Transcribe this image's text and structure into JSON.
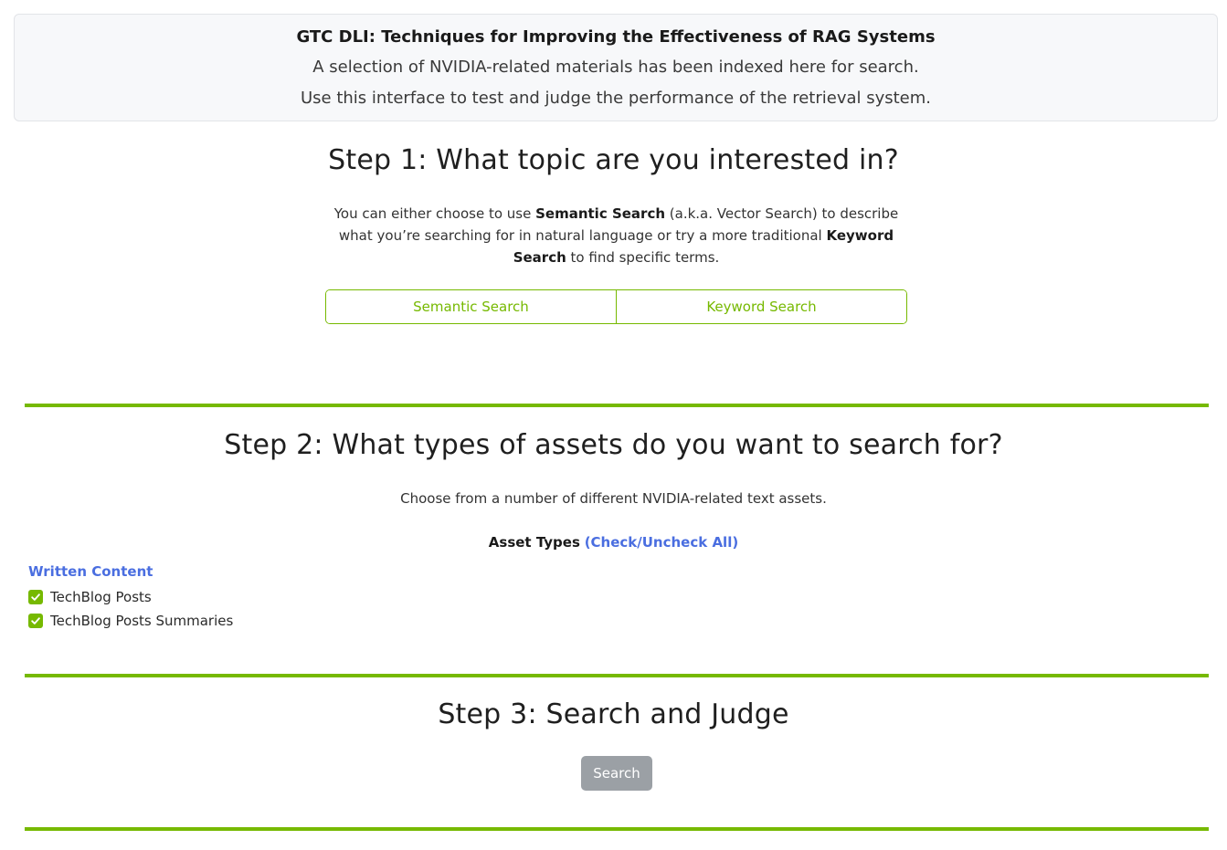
{
  "header": {
    "title": "GTC DLI: Techniques for Improving the Effectiveness of RAG Systems",
    "line1": "A selection of NVIDIA-related materials has been indexed here for search.",
    "line2": "Use this interface to test and judge the performance of the retrieval system."
  },
  "step1": {
    "title": "Step 1: What topic are you interested in?",
    "desc_part1": "You can either choose to use ",
    "desc_bold1": "Semantic Search",
    "desc_part2": " (a.k.a. Vector Search) to describe what you’re searching for in natural language or try a more traditional ",
    "desc_bold2": "Keyword Search",
    "desc_part3": " to find specific terms.",
    "options": [
      {
        "label": "Semantic Search"
      },
      {
        "label": "Keyword Search"
      }
    ]
  },
  "step2": {
    "title": "Step 2: What types of assets do you want to search for?",
    "subtitle": "Choose from a number of different NVIDIA-related text assets.",
    "asset_types_label": "Asset Types",
    "check_all_link": "(Check/Uncheck All)",
    "group_label": "Written Content",
    "items": [
      {
        "label": "TechBlog Posts",
        "checked": true
      },
      {
        "label": "TechBlog Posts Summaries",
        "checked": true
      }
    ]
  },
  "step3": {
    "title": "Step 3: Search and Judge",
    "search_label": "Search"
  },
  "colors": {
    "accent": "#76b900",
    "link": "#4a6ee0",
    "disabled_button": "#9ba0a5"
  }
}
